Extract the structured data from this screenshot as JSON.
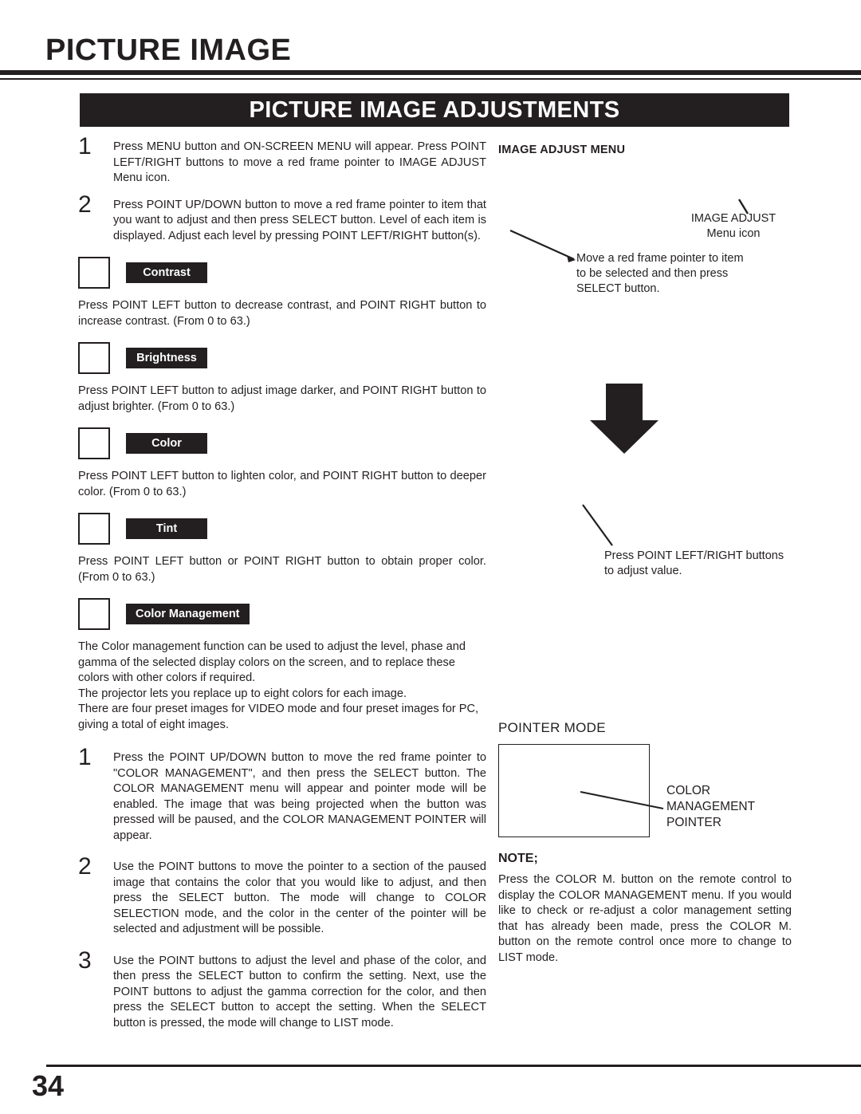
{
  "header": {
    "page_title": "PICTURE IMAGE",
    "section_banner": "PICTURE IMAGE ADJUSTMENTS"
  },
  "left_column": {
    "intro_steps": [
      {
        "number": "1",
        "text": "Press MENU button and ON-SCREEN MENU will appear.  Press POINT LEFT/RIGHT buttons to move a red frame pointer to IMAGE ADJUST Menu icon."
      },
      {
        "number": "2",
        "text": "Press POINT UP/DOWN button to move a red frame pointer to item that you want to adjust and then press SELECT button.  Level of each item is displayed.  Adjust each level by pressing POINT LEFT/RIGHT button(s)."
      }
    ],
    "items": [
      {
        "tag": "Contrast",
        "text": "Press POINT LEFT button to decrease contrast, and POINT RIGHT button to increase contrast.  (From 0 to 63.)"
      },
      {
        "tag": "Brightness",
        "text": "Press POINT LEFT button to adjust image darker, and POINT RIGHT button to adjust brighter.  (From 0 to 63.)"
      },
      {
        "tag": "Color",
        "text": "Press POINT LEFT button to lighten color, and POINT RIGHT button to deeper color.  (From 0 to 63.)"
      },
      {
        "tag": "Tint",
        "text": "Press POINT LEFT button or POINT RIGHT button to obtain proper color.  (From 0 to 63.)"
      },
      {
        "tag": "Color Management",
        "text": "The Color management function can be used to adjust the level, phase and gamma of the selected display colors on the screen, and to replace these colors with other colors if required.\nThe projector lets you replace up to eight colors for each image.\nThere are four preset images for VIDEO mode and four preset images for PC, giving a total of eight images."
      }
    ],
    "cm_steps": [
      {
        "number": "1",
        "text": "Press the POINT UP/DOWN button to move the red frame pointer to \"COLOR MANAGEMENT\", and then press the SELECT button. The COLOR MANAGEMENT menu will appear and pointer mode will be enabled. The image that was being projected when the button was pressed will be paused, and the COLOR MANAGEMENT POINTER will appear."
      },
      {
        "number": "2",
        "text": "Use the POINT buttons to move the pointer to a section of the paused image that contains the color that you would like to adjust, and then press the SELECT button. The mode will change to COLOR SELECTION mode, and the color in the center of the pointer will be selected and adjustment will be possible."
      },
      {
        "number": "3",
        "text": "Use the POINT buttons to adjust the level and phase of the color, and then press the SELECT button to confirm the setting. Next, use the POINT buttons to adjust the gamma correction for the color, and then press the SELECT button to accept the setting. When the SELECT button is pressed, the mode will change to LIST mode."
      }
    ]
  },
  "right_column": {
    "menu_heading": "IMAGE ADJUST MENU",
    "callout_icon": "IMAGE ADJUST\nMenu icon",
    "callout_icon_line1": "IMAGE ADJUST",
    "callout_icon_line2": "Menu icon",
    "callout_select": "Move a red frame pointer to item to be selected and then press SELECT button.",
    "callout_adjust": "Press POINT LEFT/RIGHT buttons to adjust value.",
    "pointer_mode_label": "POINTER MODE",
    "pointer_label_line1": "COLOR",
    "pointer_label_line2": "MANAGEMENT",
    "pointer_label_line3": "POINTER",
    "note_heading": "NOTE;",
    "note_body": "Press the COLOR M. button on the remote control to display the COLOR MANAGEMENT menu. If you would like to check or re-adjust a color management setting that has already been made, press the COLOR M. button on the remote control once more to change to LIST mode."
  },
  "footer": {
    "page_number": "34"
  },
  "colors": {
    "ink": "#231f20",
    "paper": "#ffffff"
  }
}
